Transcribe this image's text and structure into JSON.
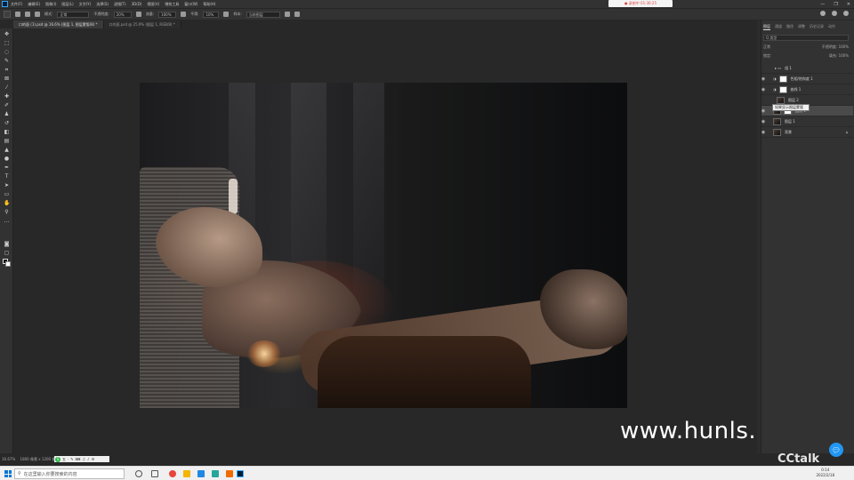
{
  "menubar": {
    "items": [
      "文件(F)",
      "编辑(E)",
      "图像(I)",
      "图层(L)",
      "文字(Y)",
      "选择(S)",
      "滤镜(T)",
      "3D(D)",
      "视图(V)",
      "增效工具",
      "窗口(W)",
      "帮助(H)"
    ],
    "recording_badge": "● 录制中 01:30:25"
  },
  "options_bar": {
    "mode_label": "模式:",
    "mode_value": "正常",
    "opacity_label": "不透明度:",
    "opacity_value": "20%",
    "flow_label": "流量:",
    "flow_value": "100%",
    "smoothing_label": "平滑:",
    "smoothing_value": "10%",
    "sample_label": "样本:",
    "sample_value": "当前图层"
  },
  "tabs": [
    {
      "label": "口的面 (1).psd @ 16.6% (图层 1, 图层蒙版/8) *",
      "active": true
    },
    {
      "label": "口的面.psd @ 25.9% (图层 1, RGB/8) *",
      "active": false
    }
  ],
  "toolbar": {
    "tools": [
      "move",
      "marquee",
      "lasso",
      "quick-select",
      "crop",
      "frame",
      "eyedropper",
      "healing",
      "brush",
      "stamp",
      "history-brush",
      "eraser",
      "gradient",
      "blur",
      "dodge",
      "pen",
      "type",
      "path-select",
      "shape",
      "hand",
      "zoom",
      "more"
    ]
  },
  "layers_panel": {
    "tabs": [
      "图层",
      "通道",
      "路径",
      "调整",
      "历史记录",
      "动作"
    ],
    "filter_label": "Q 类型",
    "blend_mode": "正常",
    "opacity_label": "不透明度:",
    "opacity_value": "100%",
    "lock_label": "锁定:",
    "fill_label": "填充:",
    "fill_value": "100%",
    "layers": [
      {
        "name": "组 1",
        "kind": "group",
        "thumb": "none",
        "visible": false,
        "selected": false
      },
      {
        "name": "色相/饱和度 1",
        "kind": "adjust",
        "thumb": "white",
        "visible": true,
        "selected": false
      },
      {
        "name": "曲线 1",
        "kind": "adjust",
        "thumb": "white",
        "visible": true,
        "selected": false
      },
      {
        "name": "图层 2",
        "kind": "pixel",
        "thumb": "dark",
        "visible": false,
        "selected": false
      },
      {
        "name": "曲线 1",
        "kind": "adjust",
        "thumb": "white",
        "visible": true,
        "selected": true
      },
      {
        "name": "图层 1",
        "kind": "pixel",
        "thumb": "dark",
        "visible": true,
        "selected": false
      },
      {
        "name": "背景",
        "kind": "background",
        "thumb": "dark",
        "visible": true,
        "selected": false
      }
    ],
    "tooltip": "如果显示图层蒙版"
  },
  "canvas": {
    "watermark": "www.hunls.com"
  },
  "statusbar": {
    "zoom": "16.67%",
    "doc_info": "1800 像素 x 1200 像素 (300 ppi)"
  },
  "ime_bar": {
    "items": [
      "S",
      "五",
      "·",
      "✎",
      "⌨",
      "♫",
      "♪",
      "☰"
    ]
  },
  "taskbar": {
    "search_placeholder": "在这里输入你要搜索的内容",
    "tray_time": "0:14",
    "tray_date": "2022/2/18"
  },
  "cctalk": {
    "logo": "CCtalk"
  },
  "colors": {
    "ps_blue": "#31a8ff",
    "win_blue": "#0078d7",
    "cctalk_blue": "#2196f3"
  }
}
